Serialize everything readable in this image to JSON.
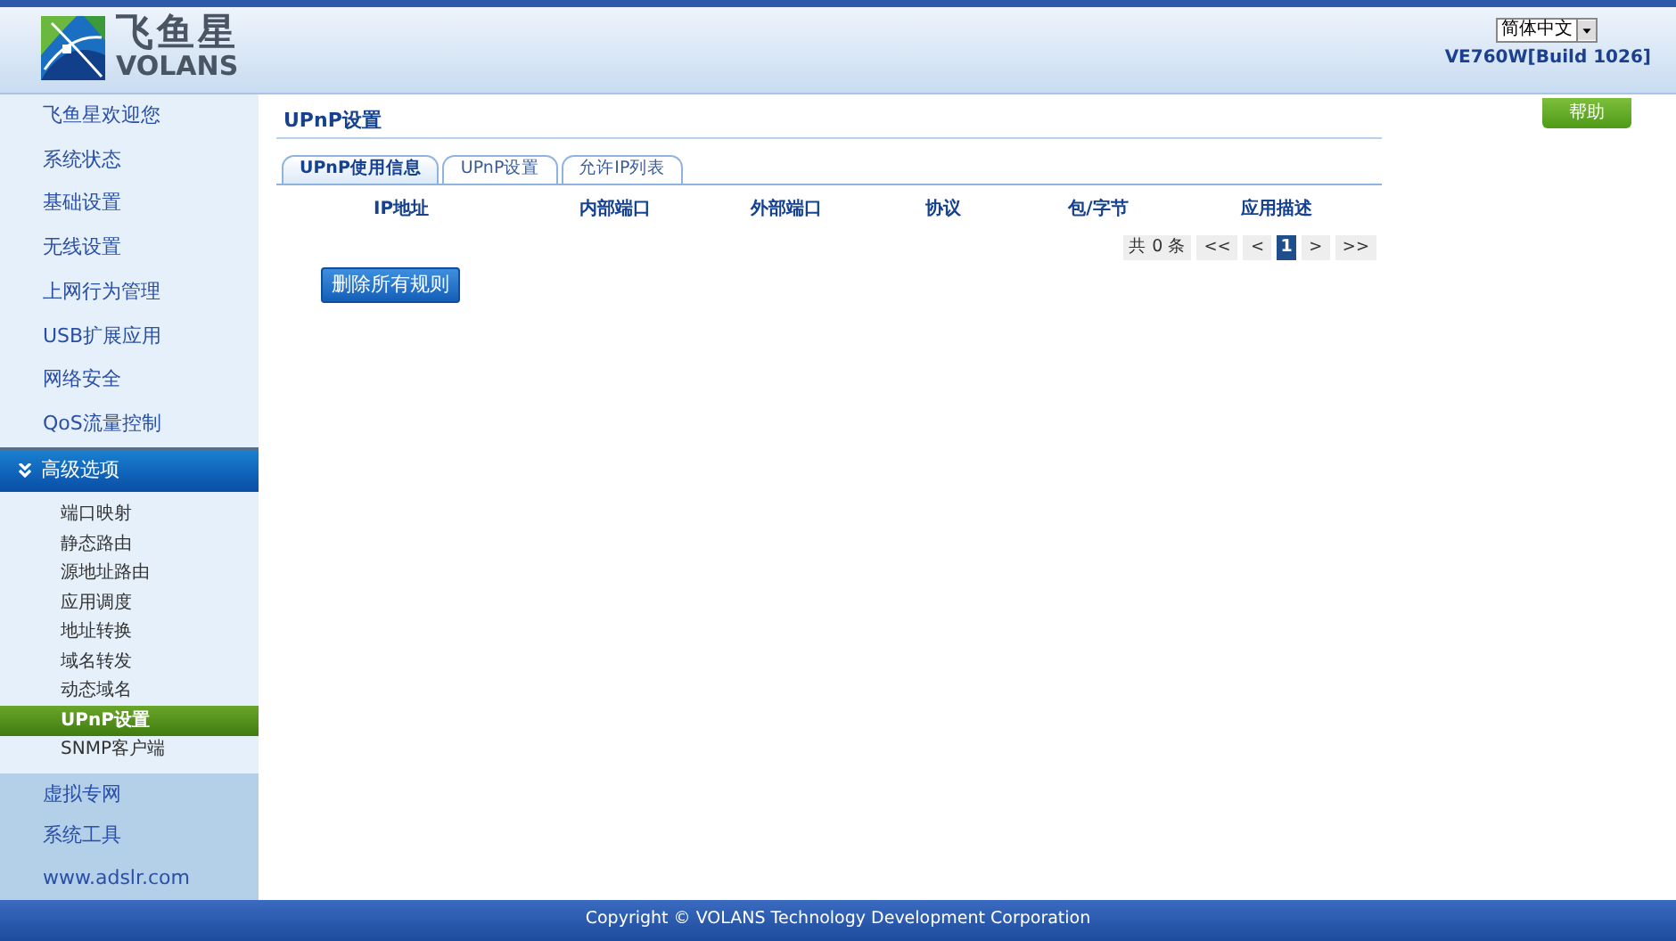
{
  "header": {
    "brand": "飞鱼星",
    "brand_sub": "VOLANS",
    "language": "简体中文",
    "version": "VE760W[Build 1026]"
  },
  "help_button": "帮助",
  "sidebar": {
    "items": [
      {
        "label": "飞鱼星欢迎您",
        "expanded": false
      },
      {
        "label": "系统状态",
        "expanded": false
      },
      {
        "label": "基础设置",
        "expanded": false
      },
      {
        "label": "无线设置",
        "expanded": false
      },
      {
        "label": "上网行为管理",
        "expanded": false
      },
      {
        "label": "USB扩展应用",
        "expanded": false
      },
      {
        "label": "网络安全",
        "expanded": false
      },
      {
        "label": "QoS流量控制",
        "expanded": false
      },
      {
        "label": "高级选项",
        "expanded": true,
        "children": [
          {
            "label": "端口映射",
            "selected": false
          },
          {
            "label": "静态路由",
            "selected": false
          },
          {
            "label": "源地址路由",
            "selected": false
          },
          {
            "label": "应用调度",
            "selected": false
          },
          {
            "label": "地址转换",
            "selected": false
          },
          {
            "label": "域名转发",
            "selected": false
          },
          {
            "label": "动态域名",
            "selected": false
          },
          {
            "label": "UPnP设置",
            "selected": true
          },
          {
            "label": "SNMP客户端",
            "selected": false
          }
        ]
      },
      {
        "label": "虚拟专网",
        "expanded": false
      },
      {
        "label": "系统工具",
        "expanded": false
      },
      {
        "label": "www.adslr.com",
        "expanded": false
      }
    ]
  },
  "page_title": "UPnP设置",
  "tabs": [
    {
      "label": "UPnP使用信息",
      "selected": true
    },
    {
      "label": "UPnP设置",
      "selected": false
    },
    {
      "label": "允许IP列表",
      "selected": false
    }
  ],
  "table": {
    "columns": [
      "IP地址",
      "内部端口",
      "外部端口",
      "协议",
      "包/字节",
      "应用描述"
    ]
  },
  "pagination": {
    "total": "共 0 条",
    "pages": [
      {
        "label": "<<",
        "selected": false
      },
      {
        "label": "<",
        "selected": false
      },
      {
        "label": "1",
        "selected": true
      },
      {
        "label": ">",
        "selected": false
      },
      {
        "label": ">>",
        "selected": false
      }
    ]
  },
  "delete_all_button": "删除所有规则",
  "footer": "Copyright © VOLANS Technology Development Corporation"
}
